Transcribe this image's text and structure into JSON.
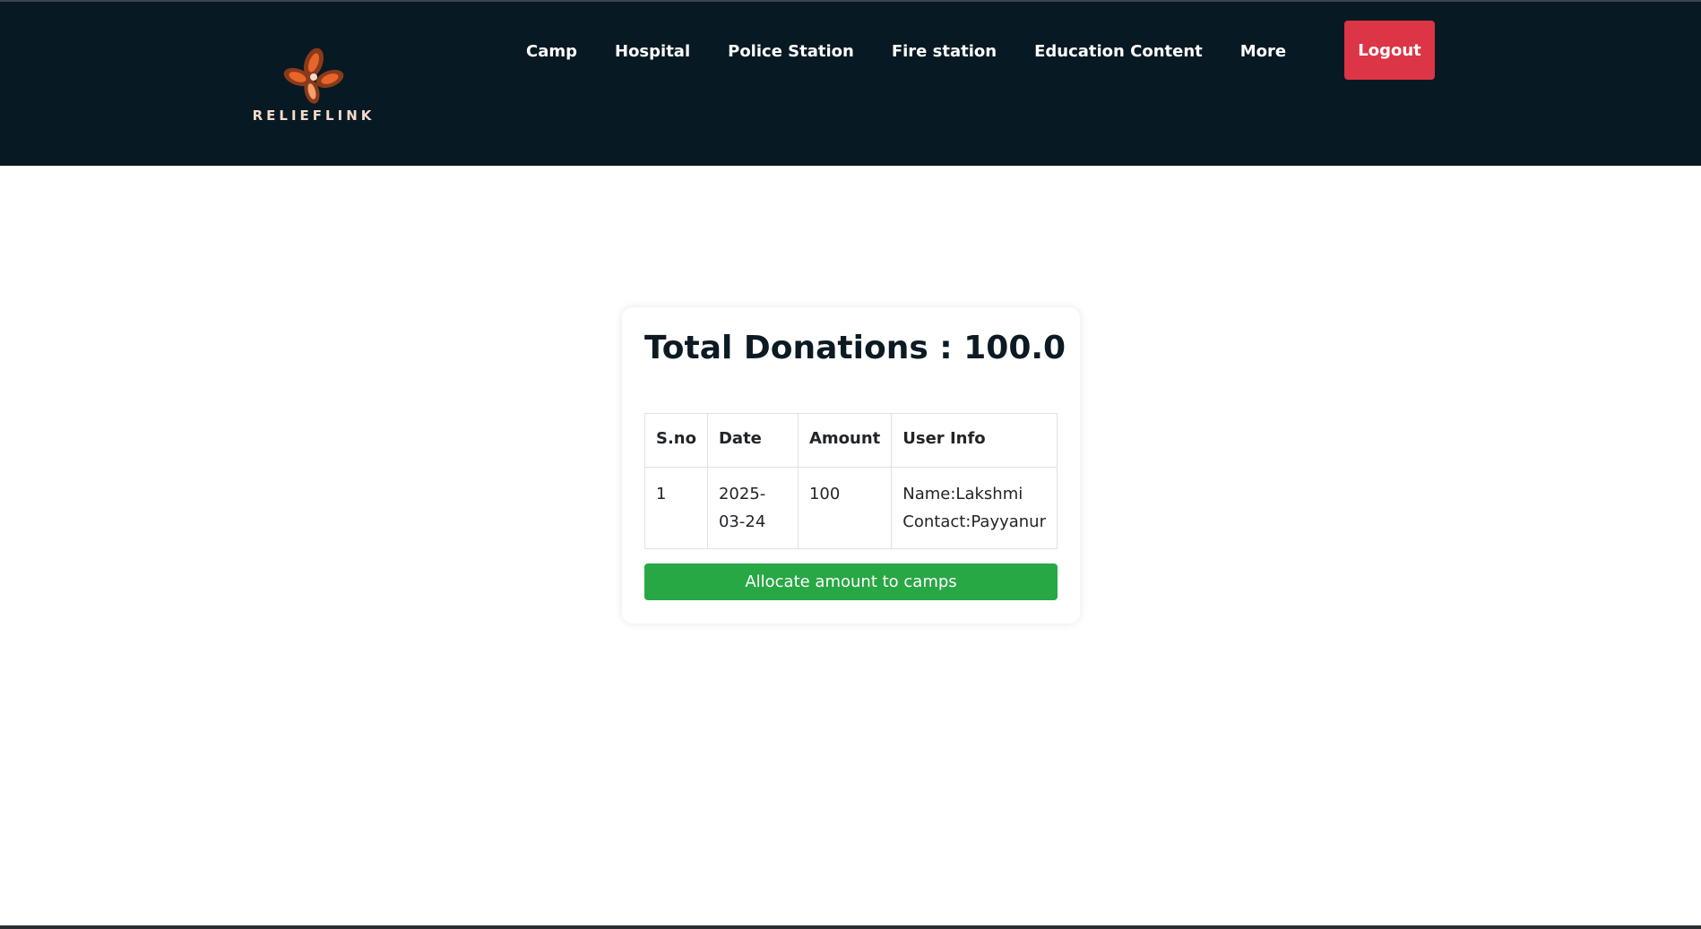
{
  "header": {
    "logo_text": "RELIEFLINK",
    "nav_items": [
      {
        "label": "Camp"
      },
      {
        "label": "Hospital"
      },
      {
        "label": "Police Station"
      },
      {
        "label": "Fire station"
      },
      {
        "label": "Education Content"
      },
      {
        "label": "More"
      }
    ],
    "logout_label": "Logout"
  },
  "main": {
    "title": "Total Donations : 100.0",
    "table": {
      "headers": [
        "S.no",
        "Date",
        "Amount",
        "User Info"
      ],
      "rows": [
        {
          "sno": "1",
          "date": "2025-03-24",
          "amount": "100",
          "user_name": "Name:Lakshmi",
          "user_contact": "Contact:Payyanur"
        }
      ]
    },
    "allocate_label": "Allocate amount to camps"
  },
  "colors": {
    "navbar_bg": "#071923",
    "logout_bg": "#dc3545",
    "allocate_bg": "#28a745",
    "logo_orange": "#e8652a",
    "logo_brown": "#8a3a1a"
  }
}
